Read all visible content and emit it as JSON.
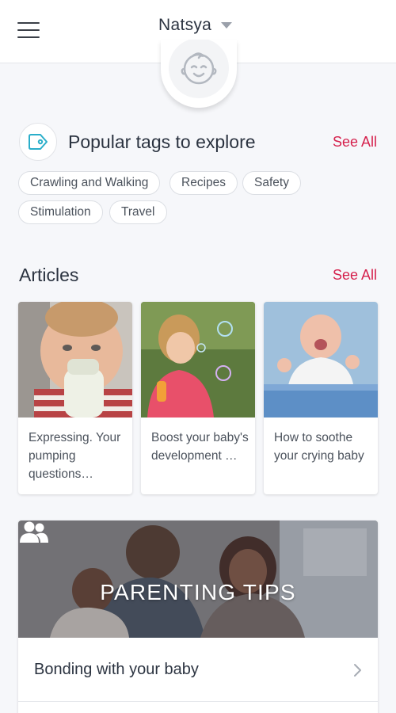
{
  "header": {
    "profile_name": "Natsya"
  },
  "tags_section": {
    "title": "Popular tags to explore",
    "see_all": "See All",
    "chips": [
      "Crawling and Walking",
      "Recipes",
      "Safety",
      "Stimulation",
      "Travel"
    ]
  },
  "articles_section": {
    "title": "Articles",
    "see_all": "See All",
    "cards": [
      {
        "title": "Expressing. Your pumping questions…"
      },
      {
        "title": "Boost your baby's development …"
      },
      {
        "title": "How to soothe your crying baby"
      }
    ]
  },
  "parenting_tips": {
    "banner_title": "PARENTING TIPS",
    "rows": [
      {
        "label": "Bonding with your baby"
      }
    ]
  },
  "colors": {
    "accent": "#d5204c",
    "text": "#2b3340",
    "background": "#f6f7fa"
  }
}
